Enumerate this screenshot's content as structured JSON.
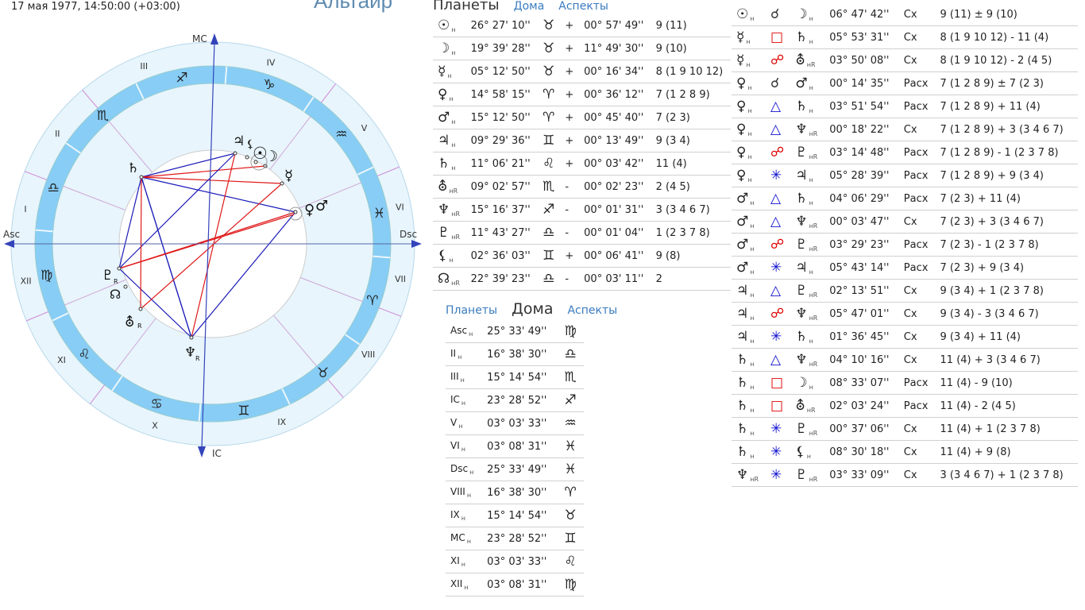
{
  "header": {
    "date": "17 мая 1977, 14:50:00 (+03:00)",
    "site_title": "Альтаир"
  },
  "tabs_planets": {
    "planets": "Планеты",
    "houses": "Дома",
    "aspects": "Аспекты"
  },
  "tabs_houses": {
    "planets": "Планеты",
    "houses": "Дома",
    "aspects": "Аспекты"
  },
  "chart": {
    "axis_labels": {
      "mc": "MC",
      "ic": "IC",
      "asc": "Asc",
      "dsc": "Dsc"
    },
    "house_numerals": [
      "I",
      "II",
      "III",
      "IV",
      "V",
      "VI",
      "VII",
      "VIII",
      "IX",
      "X",
      "XI",
      "XII"
    ],
    "retro": "R"
  },
  "planets": [
    {
      "icon": "sun-icon",
      "glyph": "☉",
      "sub": "н",
      "pos": "26° 27' 10''",
      "sign_icon": "taurus-icon",
      "sign": "♉",
      "dir": "+",
      "speed": "00° 57' 49''",
      "house": "9 (11)"
    },
    {
      "icon": "moon-icon",
      "glyph": "☽",
      "sub": "н",
      "pos": "19° 39' 28''",
      "sign_icon": "taurus-icon",
      "sign": "♉",
      "dir": "+",
      "speed": "11° 49' 30''",
      "house": "9 (10)"
    },
    {
      "icon": "mercury-icon",
      "glyph": "☿",
      "sub": "н",
      "pos": "05° 12' 50''",
      "sign_icon": "taurus-icon",
      "sign": "♉",
      "dir": "+",
      "speed": "00° 16' 34''",
      "house": "8 (1 9 10 12)"
    },
    {
      "icon": "venus-icon",
      "glyph": "♀",
      "sub": "н",
      "pos": "14° 58' 15''",
      "sign_icon": "aries-icon",
      "sign": "♈",
      "dir": "+",
      "speed": "00° 36' 12''",
      "house": "7 (1 2 8 9)"
    },
    {
      "icon": "mars-icon",
      "glyph": "♂",
      "sub": "н",
      "pos": "15° 12' 50''",
      "sign_icon": "aries-icon",
      "sign": "♈",
      "dir": "+",
      "speed": "00° 45' 40''",
      "house": "7 (2 3)"
    },
    {
      "icon": "jupiter-icon",
      "glyph": "♃",
      "sub": "н",
      "pos": "09° 29' 36''",
      "sign_icon": "gemini-icon",
      "sign": "♊",
      "dir": "+",
      "speed": "00° 13' 49''",
      "house": "9 (3 4)"
    },
    {
      "icon": "saturn-icon",
      "glyph": "♄",
      "sub": "н",
      "pos": "11° 06' 21''",
      "sign_icon": "leo-icon",
      "sign": "♌",
      "dir": "+",
      "speed": "00° 03' 42''",
      "house": "11 (4)"
    },
    {
      "icon": "uranus-icon",
      "glyph": "⛢",
      "sub": "нR",
      "pos": "09° 02' 57''",
      "sign_icon": "scorpio-icon",
      "sign": "♏",
      "dir": "-",
      "speed": "00° 02' 23''",
      "house": "2 (4 5)"
    },
    {
      "icon": "neptune-icon",
      "glyph": "♆",
      "sub": "нR",
      "pos": "15° 16' 37''",
      "sign_icon": "sagittarius-icon",
      "sign": "♐",
      "dir": "-",
      "speed": "00° 01' 31''",
      "house": "3 (3 4 6 7)"
    },
    {
      "icon": "pluto-icon",
      "glyph": "♇",
      "sub": "нR",
      "pos": "11° 43' 27''",
      "sign_icon": "libra-icon",
      "sign": "♎",
      "dir": "-",
      "speed": "00° 01' 04''",
      "house": "1 (2 3 7 8)"
    },
    {
      "icon": "lilith-icon",
      "glyph": "⚸",
      "sub": "н",
      "pos": "02° 36' 03''",
      "sign_icon": "gemini-icon",
      "sign": "♊",
      "dir": "+",
      "speed": "00° 06' 41''",
      "house": "9 (8)"
    },
    {
      "icon": "node-icon",
      "glyph": "☊",
      "sub": "нR",
      "pos": "22° 39' 23''",
      "sign_icon": "libra-icon",
      "sign": "♎",
      "dir": "-",
      "speed": "00° 03' 11''",
      "house": "2"
    }
  ],
  "houses": [
    {
      "name": "Asc",
      "pos": "25° 33' 49''",
      "sign_icon": "virgo-icon",
      "sign": "♍"
    },
    {
      "name": "II",
      "pos": "16° 38' 30''",
      "sign_icon": "libra-icon",
      "sign": "♎"
    },
    {
      "name": "III",
      "pos": "15° 14' 54''",
      "sign_icon": "scorpio-icon",
      "sign": "♏"
    },
    {
      "name": "IC",
      "pos": "23° 28' 52''",
      "sign_icon": "sagittarius-icon",
      "sign": "♐"
    },
    {
      "name": "V",
      "pos": "03° 03' 33''",
      "sign_icon": "aquarius-icon",
      "sign": "♒"
    },
    {
      "name": "VI",
      "pos": "03° 08' 31''",
      "sign_icon": "pisces-icon",
      "sign": "♓"
    },
    {
      "name": "Dsc",
      "pos": "25° 33' 49''",
      "sign_icon": "pisces-icon",
      "sign": "♓"
    },
    {
      "name": "VIII",
      "pos": "16° 38' 30''",
      "sign_icon": "aries-icon",
      "sign": "♈"
    },
    {
      "name": "IX",
      "pos": "15° 14' 54''",
      "sign_icon": "taurus-icon",
      "sign": "♉"
    },
    {
      "name": "MC",
      "pos": "23° 28' 52''",
      "sign_icon": "gemini-icon",
      "sign": "♊"
    },
    {
      "name": "XI",
      "pos": "03° 03' 33''",
      "sign_icon": "leo-icon",
      "sign": "♌"
    },
    {
      "name": "XII",
      "pos": "03° 08' 31''",
      "sign_icon": "virgo-icon",
      "sign": "♍"
    }
  ],
  "aspects": [
    {
      "p1": "☉",
      "p1sub": "н",
      "asp": "☌",
      "type": "cj",
      "p2": "☽",
      "p2sub": "н",
      "orb": "06° 47' 42''",
      "kind": "Сх",
      "houses": "9 (11) ± 9 (10)"
    },
    {
      "p1": "☿",
      "p1sub": "н",
      "asp": "□",
      "type": "sq",
      "p2": "♄",
      "p2sub": "н",
      "orb": "05° 53' 31''",
      "kind": "Сх",
      "houses": "8 (1 9 10 12) - 11 (4)"
    },
    {
      "p1": "☿",
      "p1sub": "н",
      "asp": "☍",
      "type": "op",
      "p2": "⛢",
      "p2sub": "нR",
      "orb": "03° 50' 08''",
      "kind": "Сх",
      "houses": "8 (1 9 10 12) - 2 (4 5)"
    },
    {
      "p1": "♀",
      "p1sub": "н",
      "asp": "☌",
      "type": "cj",
      "p2": "♂",
      "p2sub": "н",
      "orb": "00° 14' 35''",
      "kind": "Расх",
      "houses": "7 (1 2 8 9) ± 7 (2 3)"
    },
    {
      "p1": "♀",
      "p1sub": "н",
      "asp": "△",
      "type": "tr",
      "p2": "♄",
      "p2sub": "н",
      "orb": "03° 51' 54''",
      "kind": "Расх",
      "houses": "7 (1 2 8 9) + 11 (4)"
    },
    {
      "p1": "♀",
      "p1sub": "н",
      "asp": "△",
      "type": "tr",
      "p2": "♆",
      "p2sub": "нR",
      "orb": "00° 18' 22''",
      "kind": "Сх",
      "houses": "7 (1 2 8 9) + 3 (3 4 6 7)"
    },
    {
      "p1": "♀",
      "p1sub": "н",
      "asp": "☍",
      "type": "op",
      "p2": "♇",
      "p2sub": "нR",
      "orb": "03° 14' 48''",
      "kind": "Расх",
      "houses": "7 (1 2 8 9) - 1 (2 3 7 8)"
    },
    {
      "p1": "♀",
      "p1sub": "н",
      "asp": "✳",
      "type": "sx",
      "p2": "♃",
      "p2sub": "н",
      "orb": "05° 28' 39''",
      "kind": "Расх",
      "houses": "7 (1 2 8 9) + 9 (3 4)"
    },
    {
      "p1": "♂",
      "p1sub": "н",
      "asp": "△",
      "type": "tr",
      "p2": "♄",
      "p2sub": "н",
      "orb": "04° 06' 29''",
      "kind": "Расх",
      "houses": "7 (2 3) + 11 (4)"
    },
    {
      "p1": "♂",
      "p1sub": "н",
      "asp": "△",
      "type": "tr",
      "p2": "♆",
      "p2sub": "нR",
      "orb": "00° 03' 47''",
      "kind": "Сх",
      "houses": "7 (2 3) + 3 (3 4 6 7)"
    },
    {
      "p1": "♂",
      "p1sub": "н",
      "asp": "☍",
      "type": "op",
      "p2": "♇",
      "p2sub": "нR",
      "orb": "03° 29' 23''",
      "kind": "Расх",
      "houses": "7 (2 3) - 1 (2 3 7 8)"
    },
    {
      "p1": "♂",
      "p1sub": "н",
      "asp": "✳",
      "type": "sx",
      "p2": "♃",
      "p2sub": "н",
      "orb": "05° 43' 14''",
      "kind": "Расх",
      "houses": "7 (2 3) + 9 (3 4)"
    },
    {
      "p1": "♃",
      "p1sub": "н",
      "asp": "△",
      "type": "tr",
      "p2": "♇",
      "p2sub": "нR",
      "orb": "02° 13' 51''",
      "kind": "Сх",
      "houses": "9 (3 4) + 1 (2 3 7 8)"
    },
    {
      "p1": "♃",
      "p1sub": "н",
      "asp": "☍",
      "type": "op",
      "p2": "♆",
      "p2sub": "нR",
      "orb": "05° 47' 01''",
      "kind": "Сх",
      "houses": "9 (3 4) - 3 (3 4 6 7)"
    },
    {
      "p1": "♃",
      "p1sub": "н",
      "asp": "✳",
      "type": "sx",
      "p2": "♄",
      "p2sub": "н",
      "orb": "01° 36' 45''",
      "kind": "Сх",
      "houses": "9 (3 4) + 11 (4)"
    },
    {
      "p1": "♄",
      "p1sub": "н",
      "asp": "△",
      "type": "tr",
      "p2": "♆",
      "p2sub": "нR",
      "orb": "04° 10' 16''",
      "kind": "Сх",
      "houses": "11 (4) + 3 (3 4 6 7)"
    },
    {
      "p1": "♄",
      "p1sub": "н",
      "asp": "□",
      "type": "sq",
      "p2": "☽",
      "p2sub": "н",
      "orb": "08° 33' 07''",
      "kind": "Расх",
      "houses": "11 (4) - 9 (10)"
    },
    {
      "p1": "♄",
      "p1sub": "н",
      "asp": "□",
      "type": "sq",
      "p2": "⛢",
      "p2sub": "нR",
      "orb": "02° 03' 24''",
      "kind": "Расх",
      "houses": "11 (4) - 2 (4 5)"
    },
    {
      "p1": "♄",
      "p1sub": "н",
      "asp": "✳",
      "type": "sx",
      "p2": "♇",
      "p2sub": "нR",
      "orb": "00° 37' 06''",
      "kind": "Сх",
      "houses": "11 (4) + 1 (2 3 7 8)"
    },
    {
      "p1": "♄",
      "p1sub": "н",
      "asp": "✳",
      "type": "sx",
      "p2": "⚸",
      "p2sub": "н",
      "orb": "08° 30' 18''",
      "kind": "Сх",
      "houses": "11 (4) + 9 (8)"
    },
    {
      "p1": "♆",
      "p1sub": "нR",
      "asp": "✳",
      "type": "sx",
      "p2": "♇",
      "p2sub": "нR",
      "orb": "03° 33' 09''",
      "kind": "Сх",
      "houses": "3 (3 4 6 7) + 1 (2 3 7 8)"
    }
  ]
}
